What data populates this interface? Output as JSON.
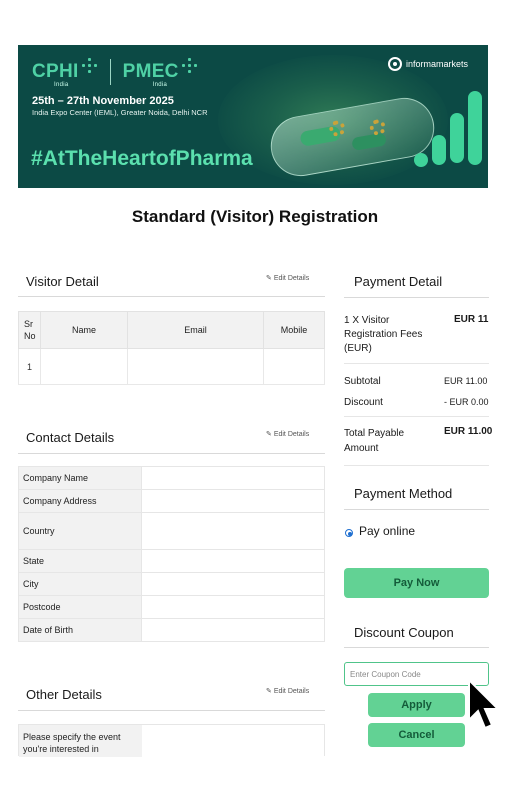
{
  "banner": {
    "cphi": "CPHI",
    "pmec": "PMEC",
    "india1": "India",
    "india2": "India",
    "date": "25th – 27th November 2025",
    "venue": "India Expo Center (IEML), Greater Noida, Delhi NCR",
    "hashtag": "#AtTheHeartofPharma",
    "informa": "informamarkets"
  },
  "page_title": "Standard (Visitor) Registration",
  "visitor_detail": {
    "title": "Visitor Detail",
    "edit_label": "Edit Details",
    "columns": [
      "Sr No",
      "Name",
      "Email",
      "Mobile"
    ],
    "rows": [
      [
        "1",
        "",
        "",
        ""
      ]
    ]
  },
  "contact_details": {
    "title": "Contact Details",
    "edit_label": "Edit Details",
    "fields": [
      "Company Name",
      "Company Address",
      "Country",
      "State",
      "City",
      "Postcode",
      "Date of Birth"
    ]
  },
  "other_details": {
    "title": "Other Details",
    "edit_label": "Edit Details",
    "field": "Please specify the event you're interested in"
  },
  "payment_detail": {
    "title": "Payment Detail",
    "item_label": "1 X Visitor Registration Fees (EUR)",
    "item_amount": "EUR 11",
    "subtotal_label": "Subtotal",
    "subtotal_value": "EUR 11.00",
    "discount_label": "Discount",
    "discount_value": "- EUR 0.00",
    "total_label": "Total Payable Amount",
    "total_value": "EUR 11.00"
  },
  "payment_method": {
    "title": "Payment Method",
    "option": "Pay online",
    "pay_button": "Pay Now"
  },
  "discount_coupon": {
    "title": "Discount Coupon",
    "placeholder": "Enter Coupon Code",
    "apply_button": "Apply",
    "cancel_button": "Cancel"
  },
  "colors": {
    "banner_bg": "#0c4a45",
    "brand_green": "#4fd1a5",
    "button_green": "#62d294",
    "radio_blue": "#1f6fd0"
  }
}
